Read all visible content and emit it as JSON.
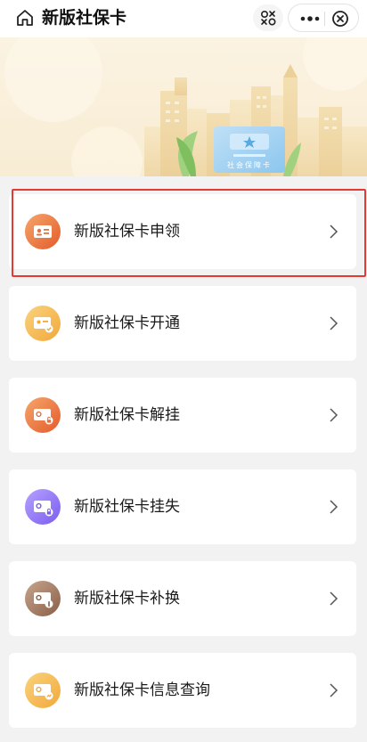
{
  "header": {
    "title": "新版社保卡"
  },
  "banner": {
    "card_text": "社会保障卡"
  },
  "menu": [
    {
      "label": "新版社保卡申领",
      "icon": "id-card-icon",
      "color_from": "#f6a66a",
      "color_to": "#e35b2c"
    },
    {
      "label": "新版社保卡开通",
      "icon": "card-check-icon",
      "color_from": "#fbd27e",
      "color_to": "#f0a93a"
    },
    {
      "label": "新版社保卡解挂",
      "icon": "card-unlock-icon",
      "color_from": "#f6a66a",
      "color_to": "#e35b2c"
    },
    {
      "label": "新版社保卡挂失",
      "icon": "card-lock-icon",
      "color_from": "#b6a2ff",
      "color_to": "#7a5cf0"
    },
    {
      "label": "新版社保卡补换",
      "icon": "card-replace-icon",
      "color_from": "#c7a58f",
      "color_to": "#8a5f45"
    },
    {
      "label": "新版社保卡信息查询",
      "icon": "card-search-icon",
      "color_from": "#fbd27e",
      "color_to": "#f0a93a"
    }
  ],
  "colors": {
    "highlight": "#e53935",
    "background": "#f2f2f2"
  }
}
